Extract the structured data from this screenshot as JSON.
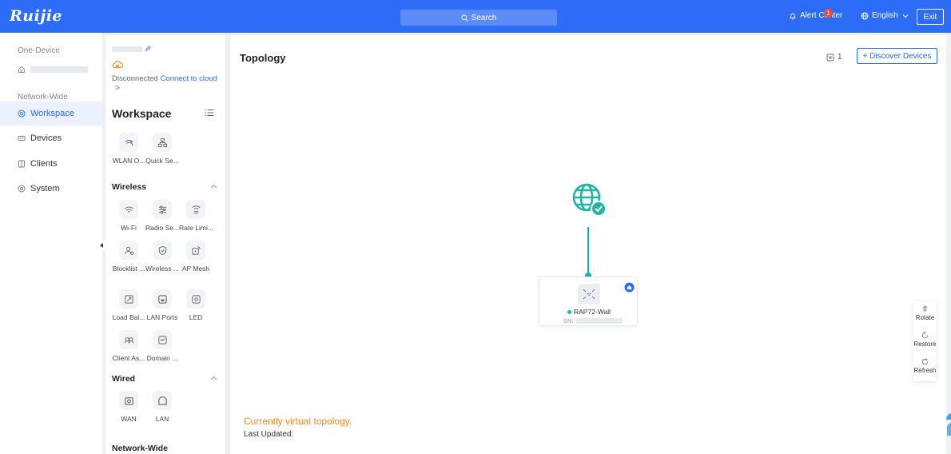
{
  "header": {
    "logo": "Ruijie",
    "search_label": "Search",
    "alert_label": "Alert Center",
    "alert_count": "1",
    "language_label": "English",
    "exit_label": "Exit"
  },
  "leftnav": {
    "section_one_device": "One-Device",
    "section_network_wide": "Network-Wide",
    "items": [
      {
        "label": "Workspace",
        "icon": "workspace-icon",
        "active": true
      },
      {
        "label": "Devices",
        "icon": "devices-icon"
      },
      {
        "label": "Clients",
        "icon": "clients-icon"
      },
      {
        "label": "System",
        "icon": "system-icon"
      }
    ]
  },
  "panel": {
    "status": "Disconnected",
    "connect_link": "Connect to cloud",
    "connect_arrow": ">",
    "workspace_title": "Workspace",
    "top_tiles": [
      {
        "label": "WLAN O...",
        "icon": "wlan-optimization-icon"
      },
      {
        "label": "Quick Se...",
        "icon": "quick-setup-icon"
      }
    ],
    "wireless_title": "Wireless",
    "wireless_tiles": [
      {
        "label": "Wi-Fi",
        "icon": "wifi-icon"
      },
      {
        "label": "Radio Se...",
        "icon": "radio-settings-icon"
      },
      {
        "label": "Rate Limi...",
        "icon": "rate-limit-icon"
      },
      {
        "label": "Blocklist ...",
        "icon": "blocklist-icon"
      },
      {
        "label": "Wireless ...",
        "icon": "wireless-security-icon"
      },
      {
        "label": "AP Mesh",
        "icon": "ap-mesh-icon"
      },
      {
        "label": "Load Bal...",
        "icon": "load-balancing-icon"
      },
      {
        "label": "LAN Ports",
        "icon": "lan-ports-icon"
      },
      {
        "label": "LED",
        "icon": "led-icon"
      },
      {
        "label": "Client As...",
        "icon": "client-association-icon"
      },
      {
        "label": "Domain ...",
        "icon": "domain-icon"
      }
    ],
    "wired_title": "Wired",
    "wired_tiles": [
      {
        "label": "WAN",
        "icon": "wan-icon"
      },
      {
        "label": "LAN",
        "icon": "lan-icon"
      }
    ],
    "next_section_partial": "Network-Wide"
  },
  "main": {
    "title": "Topology",
    "unknown_count": "1",
    "discover_label": "+ Discover Devices",
    "node": {
      "name": "RAP72-Wall",
      "sn_label": "SN:",
      "status_color": "#1cbaa6"
    },
    "virtual_note": "Currently virtual topology.",
    "last_updated": "Last Updated:",
    "tools": [
      "Rotate",
      "Restore",
      "Refresh"
    ]
  },
  "colors": {
    "brand": "#2d6cf6",
    "link": "#17b3a8",
    "warning": "#f58a1f",
    "badge": "#f5483b"
  }
}
